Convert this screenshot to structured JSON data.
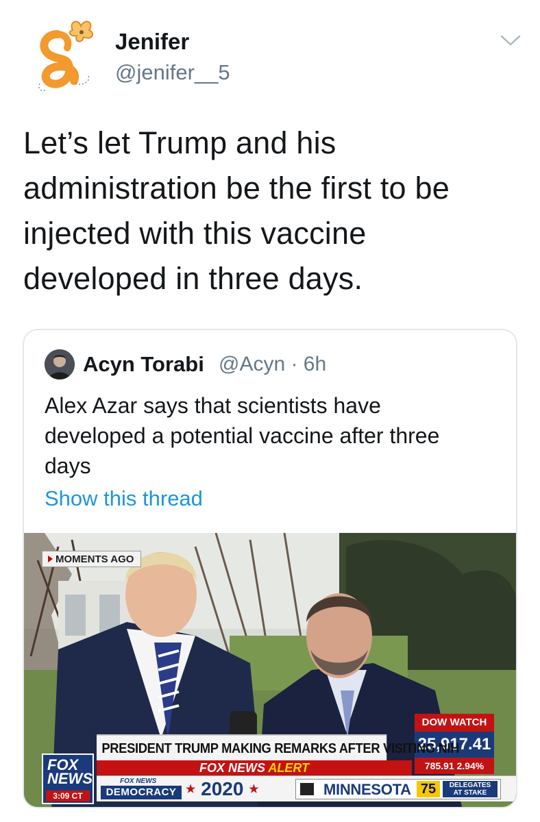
{
  "tweet": {
    "author_name": "Jenifer",
    "author_handle": "@jenifer__5",
    "text_lines": [
      "Let’s let Trump and his",
      "administration be the first to be",
      "injected with this vaccine",
      "developed in three days."
    ]
  },
  "quoted_tweet": {
    "author_name": "Acyn Torabi",
    "author_handle": "@Acyn · 6h",
    "text_lines": [
      "Alex Azar says that scientists have",
      "developed a potential vaccine after three",
      "days"
    ],
    "show_thread_label": "Show this thread"
  },
  "video": {
    "moments_label": "MOMENTS AGO",
    "chyron": "PRESIDENT TRUMP MAKING REMARKS AFTER VISITING NIH",
    "alert_fox": "FOX NEWS",
    "alert_word": "ALERT",
    "dow_title": "DOW WATCH",
    "dow_value": "25,917.41",
    "dow_change": "785.91 2.94%",
    "democracy_small": "FOX NEWS",
    "democracy_big": "DEMOCRACY",
    "year": "2020",
    "state": "MINNESOTA",
    "delegates_num": "75",
    "delegates_line1": "DELEGATES",
    "delegates_line2": "AT STAKE",
    "logo_line1": "FOX",
    "logo_line2": "NEWS",
    "time": "3:09 CT"
  },
  "colors": {
    "link_blue": "#1b95e0",
    "muted_gray": "#657786",
    "fox_red": "#c41212",
    "fox_blue": "#1a3a7a",
    "avatar_orange": "#f29a2e"
  },
  "icons": {
    "menu": "chevron-down-icon",
    "avatar": "butterfly-logo-icon"
  }
}
